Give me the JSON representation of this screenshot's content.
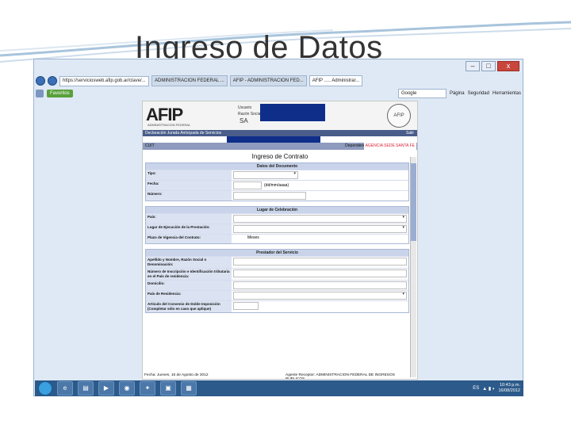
{
  "slide": {
    "title": "Ingreso de Datos"
  },
  "window": {
    "min": "–",
    "max": "□",
    "close": "x"
  },
  "browser": {
    "address": "https://serviciosweb.afip.gob.ar/clave/...",
    "tabs": [
      "ADMINISTRACION FEDERAL ...",
      "AFIP - ADMINISTRACION FED...",
      "AFIP ..... Administrar..."
    ],
    "toolbar": {
      "favorites": "Favoritos",
      "search_placeholder": "Google",
      "page": "Página",
      "security": "Seguridad",
      "tools": "Herramientas"
    }
  },
  "afip": {
    "logo": "AFIP",
    "logo_sub": "ADMINISTRACION FEDERAL",
    "user_line1": "Usuario",
    "user_line2": "Razón Social",
    "user_sa": "SA",
    "seal": "AFIP",
    "section_bar": "Declaración Jurada Anticipada de Servicios",
    "exit": "Salir",
    "cuit_label": "CUIT",
    "dependency_label": "Dependencia:",
    "dependency_value": "AGENCIA SEDE SANTA FE"
  },
  "form": {
    "title": "Ingreso de Contrato",
    "sections": [
      {
        "title": "Datos del Documento",
        "rows": [
          {
            "label": "Tipo:",
            "value": ""
          },
          {
            "label": "Fecha:",
            "value": "(dd/mm/aaaa)"
          },
          {
            "label": "Número:",
            "value": ""
          }
        ]
      },
      {
        "title": "Lugar de Celebración",
        "rows": [
          {
            "label": "País:",
            "value": ""
          },
          {
            "label": "Lugar de Ejecución de la Prestación:",
            "value": ""
          },
          {
            "label": "Plazo de Vigencia del Contrato:",
            "value": "Meses"
          }
        ]
      },
      {
        "title": "Prestador del Servicio",
        "rows": [
          {
            "label": "Apellido y Nombre, Razón Social o Denominación:",
            "value": ""
          },
          {
            "label": "Número de Inscripción e Identificación tributaria en el País de residencia:",
            "value": ""
          },
          {
            "label": "Domicilio:",
            "value": ""
          },
          {
            "label": "País de Residencia:",
            "value": ""
          },
          {
            "label": "Artículo del Convenio de Doble Imposición (Completar sólo en caso que aplique)",
            "value": ""
          }
        ]
      }
    ],
    "footer_date": "Fecha: Jueves, 16 de Agosto de 2012",
    "footer_provider": "Agente Receptor: ADMINISTRACION FEDERAL DE INGRESOS PUBLICOS"
  },
  "taskbar": {
    "lang": "ES",
    "time": "10:43 p.m.",
    "date": "16/08/2012"
  }
}
